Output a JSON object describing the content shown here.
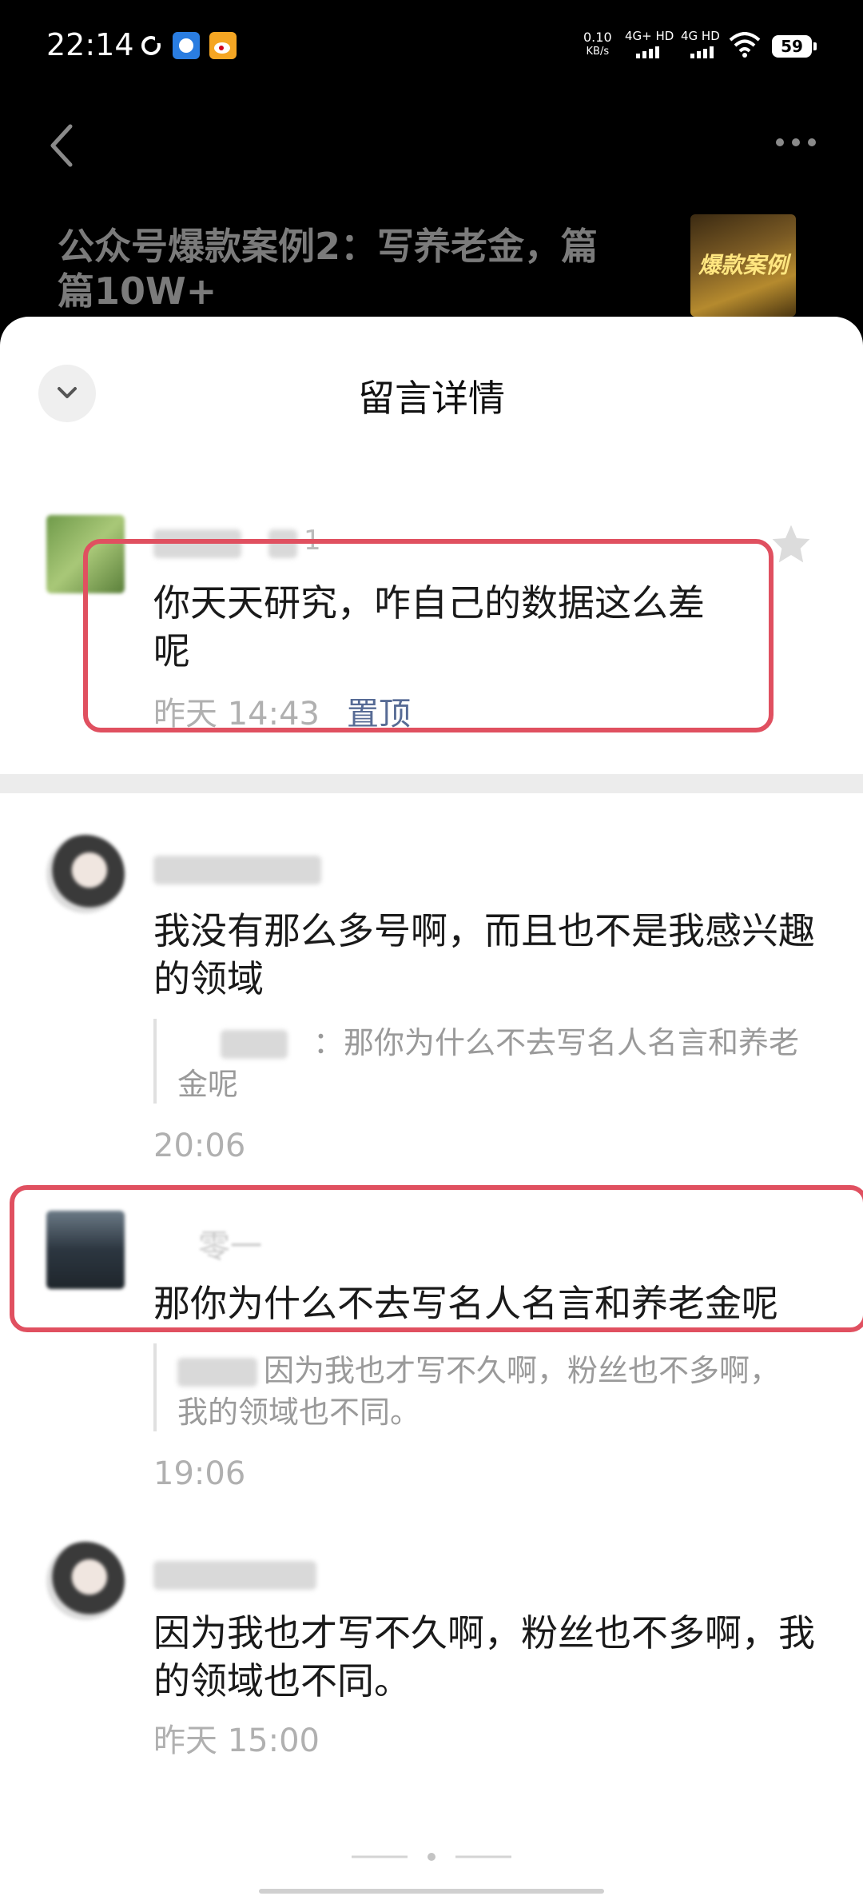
{
  "status_bar": {
    "time": "22:14",
    "net_speed_value": "0.10",
    "net_speed_unit": "KB/s",
    "signal1_label": "4G+ HD",
    "signal2_label": "4G HD",
    "battery": "59",
    "icons": [
      "sync-icon",
      "app-icon",
      "weibo-icon",
      "wifi-icon"
    ]
  },
  "article": {
    "title": "公众号爆款案例2：写养老金，篇篇10W+",
    "thumb_text": "爆款案例"
  },
  "sheet": {
    "title": "留言详情"
  },
  "top_comment": {
    "text": "你天天研究，咋自己的数据这么差呢",
    "time": "昨天 14:43",
    "pin_label": "置顶",
    "like_count": "1"
  },
  "replies": [
    {
      "text": "我没有那么多号啊，而且也不是我感兴趣的领域",
      "quote": "：那你为什么不去写名人名言和养老金呢",
      "time": "20:06"
    },
    {
      "name": "零一",
      "text": "那你为什么不去写名人名言和养老金呢",
      "quote": "因为我也才写不久啊，粉丝也不多啊，我的领域也不同。",
      "time": "19:06"
    },
    {
      "text": "因为我也才写不久啊，粉丝也不多啊，我的领域也不同。",
      "time": "昨天 15:00"
    }
  ],
  "colors": {
    "highlight": "#e05060",
    "link": "#576b95",
    "meta": "#b0b0b0"
  }
}
